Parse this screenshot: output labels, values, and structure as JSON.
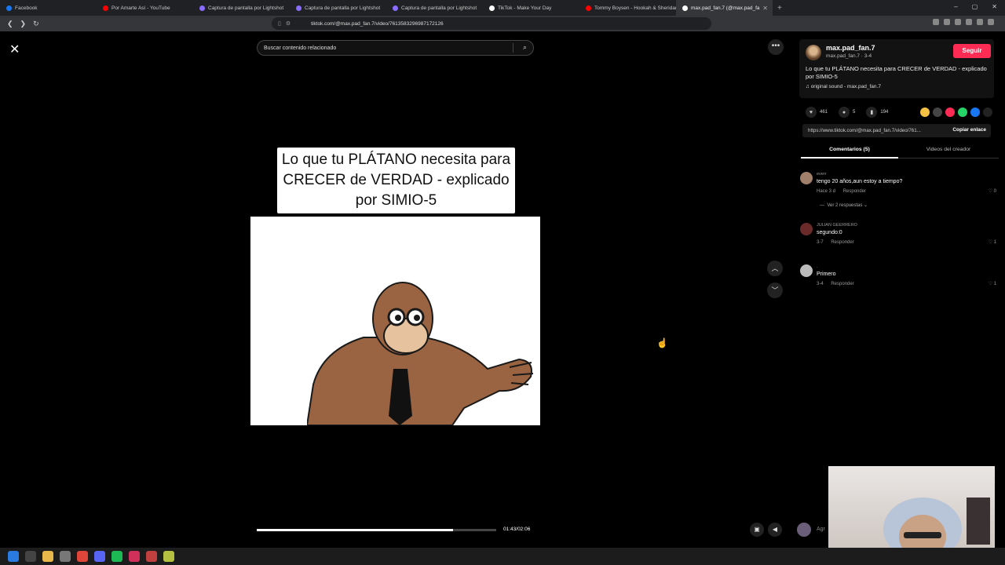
{
  "browser": {
    "tabs": [
      {
        "title": "Facebook",
        "color": "#1877f2",
        "active": false
      },
      {
        "title": "Por Amarte Así - YouTube",
        "color": "#ff0000",
        "active": false
      },
      {
        "title": "Captura de pantalla por Lightshot",
        "color": "#8a6cff",
        "active": false
      },
      {
        "title": "Captura de pantalla por Lightshot",
        "color": "#8a6cff",
        "active": false
      },
      {
        "title": "Captura de pantalla por Lightshot",
        "color": "#8a6cff",
        "active": false
      },
      {
        "title": "TikTok - Make Your Day",
        "color": "#ffffff",
        "active": false
      },
      {
        "title": "Tommy Boysen - Hookah & Sheridan",
        "color": "#ff0000",
        "active": false
      },
      {
        "title": "max.pad_fan.7 (@max.pad_fa",
        "color": "#ffffff",
        "active": true
      }
    ],
    "url": "tiktok.com/@max.pad_fan.7/video/7613583296987172126",
    "window_controls": [
      "–",
      "▢",
      "✕"
    ]
  },
  "player": {
    "search_placeholder": "Buscar contenido relacionado",
    "video_caption": "Lo que tu PLÁTANO necesita para CRECER de VERDAD - explicado por SIMIO-5",
    "time": "01:43/02:06",
    "progress": 0.82
  },
  "profile": {
    "name": "max.pad_fan.7",
    "handle": "max.pad_fan.7 · 3-4",
    "follow_label": "Seguir",
    "description": "Lo que tu PLÁTANO necesita para CRECER de VERDAD - explicado por SIMIO-5",
    "sound": "original sound - max.pad_fan.7"
  },
  "stats": {
    "likes": "461",
    "comments": "5",
    "saves": "194"
  },
  "share": {
    "link": "https://www.tiktok.com/@max.pad_fan.7/video/761...",
    "copy_label": "Copiar enlace",
    "colors": [
      "#f6c244",
      "#444444",
      "#fe2c55",
      "#25d366",
      "#1877f2",
      "#222222"
    ]
  },
  "tabs": {
    "comments": "Comentarios (5)",
    "creator_videos": "Videos del creador"
  },
  "comments": [
    {
      "user": "everr",
      "text": "tengo 20 años,aun estoy a tiempo?",
      "time": "Hace 3 d",
      "reply": "Responder",
      "likes": "0",
      "replies": "Ver 2 respuestas",
      "avatar": "#a0806a"
    },
    {
      "user": "JULIAN GEERRERO",
      "text": "segundo:0",
      "time": "3-7",
      "reply": "Responder",
      "likes": "1",
      "replies": "",
      "avatar": "#6a2a2a"
    },
    {
      "user": ".",
      "text": "Primero",
      "time": "3-4",
      "reply": "Responder",
      "likes": "1",
      "replies": "",
      "avatar": "#bbbbbb"
    }
  ],
  "icons": {
    "close": "✕",
    "search": "⌕",
    "more": "•••",
    "up": "︿",
    "down": "﹀",
    "heart": "♥",
    "comment": "●",
    "bookmark": "▮",
    "music": "♫"
  },
  "controls": {
    "add_label": "Agr"
  }
}
